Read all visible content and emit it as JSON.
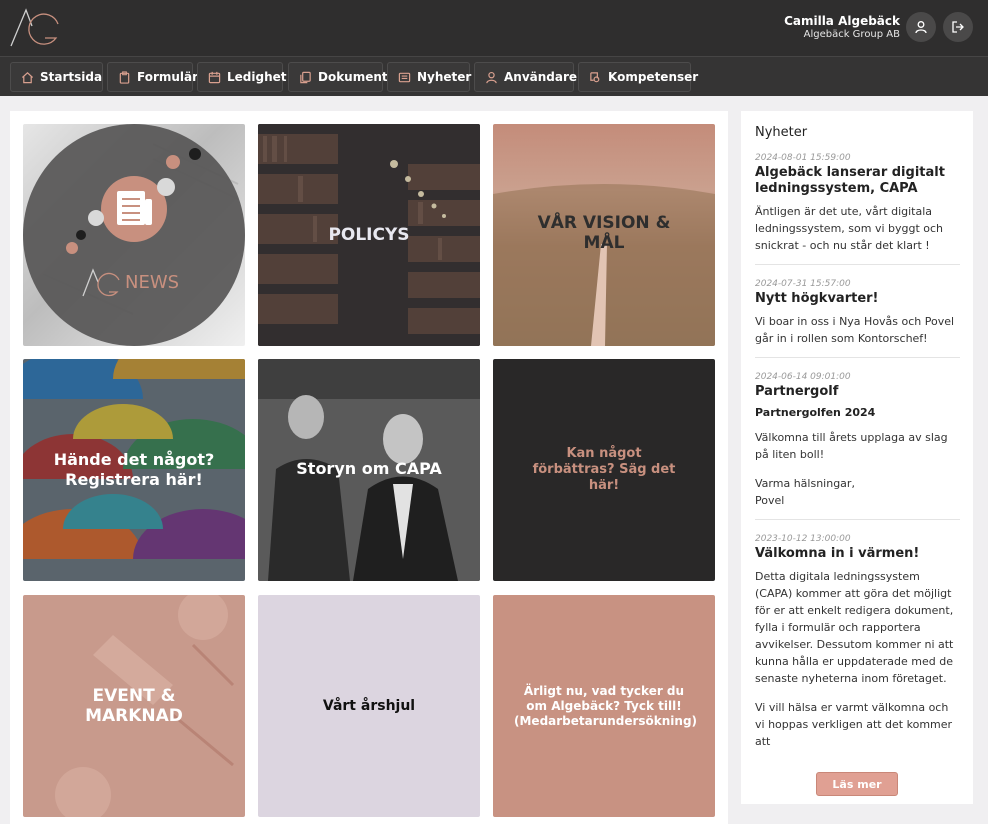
{
  "header": {
    "user_name": "Camilla Algebäck",
    "company": "Algebäck Group AB"
  },
  "nav": [
    {
      "label": "Startsida",
      "icon": "home-icon"
    },
    {
      "label": "Formulär",
      "icon": "clipboard-icon"
    },
    {
      "label": "Ledighet",
      "icon": "calendar-icon"
    },
    {
      "label": "Dokument",
      "icon": "documents-icon"
    },
    {
      "label": "Nyheter",
      "icon": "newspaper-icon"
    },
    {
      "label": "Användare",
      "icon": "user-icon"
    },
    {
      "label": "Kompetenser",
      "icon": "certificate-icon"
    }
  ],
  "tiles": {
    "news": "NEWS",
    "policys": "POLICYS",
    "vision": "VÅR VISION & MÅL",
    "incident": "Hände det något? Registrera här!",
    "story": "Storyn om CAPA",
    "improve": "Kan något förbättras? Säg det här!",
    "event": "EVENT & MARKNAD",
    "year": "Vårt årshjul",
    "survey": "Ärligt nu, vad tycker du om Algebäck? Tyck till! (Medarbetarundersökning)"
  },
  "colors": {
    "accent": "#c8907f",
    "button": "#e0a093",
    "topbar": "#2f2e2e"
  },
  "sidebar": {
    "title": "Nyheter",
    "more_label": "Läs mer",
    "news": [
      {
        "date": "2024-08-01 15:59:00",
        "title": "Algebäck lanserar digitalt ledningssystem, CAPA",
        "body": [
          "Äntligen är det ute, vårt digitala ledningssystem, som vi byggt och snickrat - och nu står det klart !"
        ]
      },
      {
        "date": "2024-07-31 15:57:00",
        "title": "Nytt högkvarter!",
        "body": [
          "Vi boar in oss i Nya Hovås och Povel går in i rollen som Kontorschef!"
        ]
      },
      {
        "date": "2024-06-14 09:01:00",
        "title": "Partnergolf",
        "subtitle": "Partnergolfen 2024",
        "body": [
          "Välkomna till årets upplaga av slag på liten boll!",
          "Varma hälsningar,\nPovel"
        ]
      },
      {
        "date": "2023-10-12 13:00:00",
        "title": "Välkomna in i värmen!",
        "body": [
          "Detta digitala ledningssystem (CAPA) kommer att göra det möjligt för er att enkelt redigera dokument, fylla i formulär och rapportera avvikelser. Dessutom kommer ni att kunna hålla er uppdaterade med de senaste nyheterna inom företaget.",
          "Vi vill hälsa er varmt välkomna och vi hoppas verkligen att det kommer att"
        ]
      }
    ]
  }
}
